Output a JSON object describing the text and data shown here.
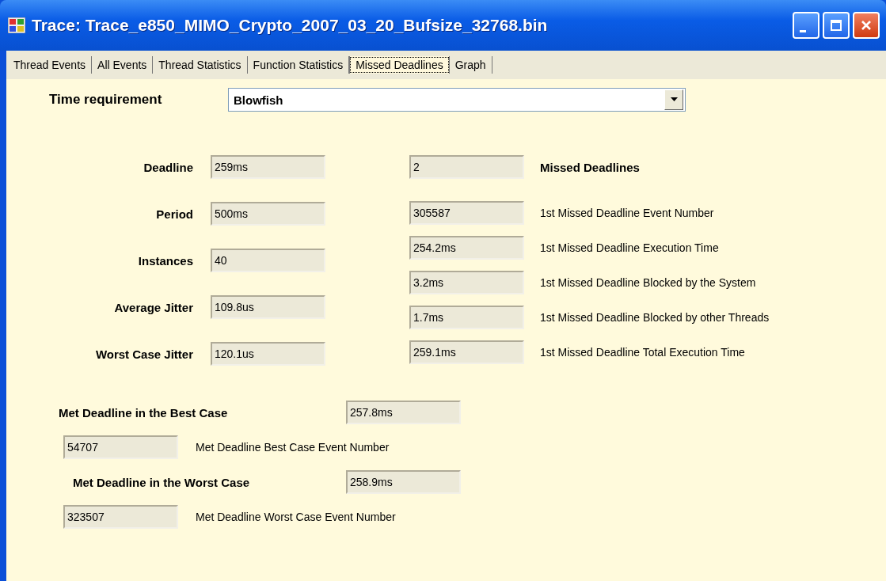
{
  "window": {
    "title": "Trace: Trace_e850_MIMO_Crypto_2007_03_20_Bufsize_32768.bin"
  },
  "tabs": [
    {
      "label": "Thread Events",
      "selected": false
    },
    {
      "label": "All Events",
      "selected": false
    },
    {
      "label": "Thread Statistics",
      "selected": false
    },
    {
      "label": "Function Statistics",
      "selected": false
    },
    {
      "label": "Missed Deadlines",
      "selected": true
    },
    {
      "label": "Graph",
      "selected": false
    }
  ],
  "time_requirement": {
    "label": "Time requirement",
    "value": "Blowfish"
  },
  "left_fields": [
    {
      "label": "Deadline",
      "value": "259ms"
    },
    {
      "label": "Period",
      "value": "500ms"
    },
    {
      "label": "Instances",
      "value": "40"
    },
    {
      "label": "Average Jitter",
      "value": "109.8us"
    },
    {
      "label": "Worst Case Jitter",
      "value": "120.1us"
    }
  ],
  "right_fields": [
    {
      "kind": "header",
      "value": "2",
      "label": "Missed Deadlines"
    },
    {
      "kind": "detail",
      "value": "305587",
      "label": "1st Missed Deadline Event Number"
    },
    {
      "kind": "detail",
      "value": "254.2ms",
      "label": "1st Missed Deadline Execution Time"
    },
    {
      "kind": "detail",
      "value": "3.2ms",
      "label": "1st Missed Deadline Blocked by the System"
    },
    {
      "kind": "detail",
      "value": "1.7ms",
      "label": "1st Missed Deadline Blocked by other Threads"
    },
    {
      "kind": "detail",
      "value": "259.1ms",
      "label": "1st Missed Deadline Total Execution Time"
    }
  ],
  "cases": [
    {
      "heading": "Met Deadline in the Best Case",
      "value": "257.8ms",
      "event_value": "54707",
      "event_label": "Met Deadline Best Case Event Number"
    },
    {
      "heading": "Met Deadline in the Worst Case",
      "value": "258.9ms",
      "event_value": "323507",
      "event_label": "Met Deadline Worst Case Event Number"
    }
  ]
}
